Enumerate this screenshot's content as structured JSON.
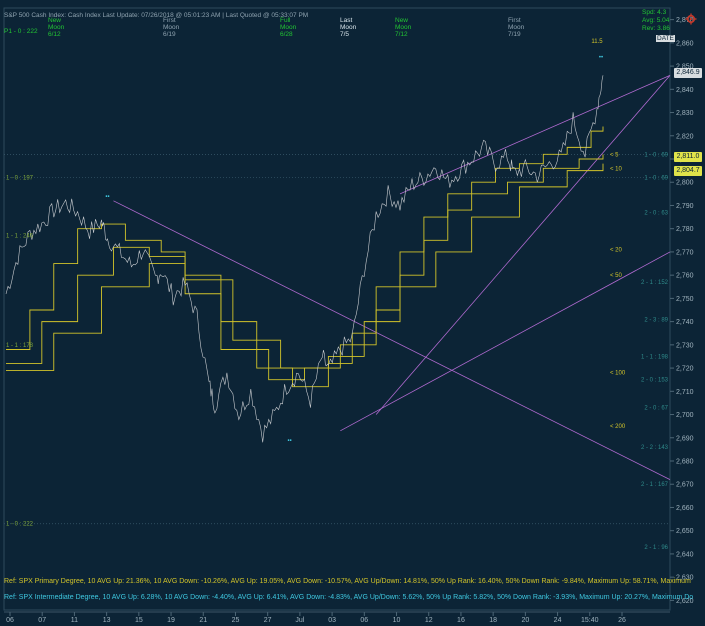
{
  "header": {
    "title": "S&P 500 Cash Index:  Cash Index   Last Update:   07/26/2018 @ 05:01:23 AM | Last Quoted @ 05:33:07 PM",
    "row2_left": "P1 - 0 : 222",
    "lunar": [
      {
        "top": "New",
        "mid": "Moon",
        "date": "6/12",
        "color": "#22c433"
      },
      {
        "top": "First",
        "mid": "Moon",
        "date": "6/19",
        "color": "#8fa3b0"
      },
      {
        "top": "Full",
        "mid": "Moon",
        "date": "6/28",
        "color": "#22c433"
      },
      {
        "top": "Last",
        "mid": "Moon",
        "date": "7/5",
        "color": "#d8e4ea"
      },
      {
        "top": "New",
        "mid": "Moon",
        "date": "7/12",
        "color": "#22c433"
      },
      {
        "top": "First",
        "mid": "Moon",
        "date": "7/19",
        "color": "#8fa3b0"
      }
    ],
    "right_legend": [
      {
        "label": "Spd: 4.3",
        "color": "#22c433"
      },
      {
        "label": "Avg: 5.04",
        "color": "#22c433"
      },
      {
        "label": "Rev: 3.86",
        "color": "#22c433"
      }
    ],
    "right_badge": "DATE"
  },
  "chart_data": {
    "type": "line",
    "title": "S&P 500 Cash Index",
    "xlabel": "",
    "ylabel": "",
    "ylim": [
      2620,
      2875
    ],
    "yticks": [
      2620,
      2630,
      2640,
      2650,
      2660,
      2670,
      2680,
      2690,
      2700,
      2710,
      2720,
      2730,
      2740,
      2750,
      2760,
      2770,
      2780,
      2790,
      2800,
      2810,
      2820,
      2830,
      2840,
      2850,
      2860,
      2870
    ],
    "ytick_labels": [
      "2,620",
      "2,630",
      "2,640",
      "2,650",
      "2,660",
      "2,670",
      "2,680",
      "2,690",
      "2,700",
      "2,710",
      "2,720",
      "2,730",
      "2,740",
      "2,750",
      "2,760",
      "2,770",
      "2,780",
      "2,790",
      "2,800",
      "2,810",
      "2,820",
      "2,830",
      "2,840",
      "2,850",
      "2,860",
      "2,870"
    ],
    "xtick_labels": [
      "06",
      "07",
      "11",
      "13",
      "15",
      "19",
      "21",
      "25",
      "27",
      "Jul",
      "03",
      "06",
      "10",
      "12",
      "16",
      "18",
      "20",
      "24",
      "15:40",
      "26"
    ],
    "price_series": {
      "name": "SPX",
      "color": "#c9ccd0",
      "x": [
        0,
        2,
        4,
        6,
        8,
        10,
        12,
        14,
        16,
        17,
        19,
        21,
        23,
        25,
        26,
        28,
        30,
        32,
        34,
        35,
        37,
        39,
        41,
        43,
        45,
        47,
        49,
        51,
        53,
        54,
        56,
        58,
        60,
        62,
        64,
        66,
        68,
        70,
        72,
        74,
        76,
        78,
        80,
        82,
        84,
        85,
        87,
        89,
        91,
        93,
        95,
        97,
        99,
        100
      ],
      "y": [
        2752,
        2768,
        2778,
        2782,
        2788,
        2791,
        2787,
        2779,
        2783,
        2776,
        2770,
        2764,
        2771,
        2758,
        2762,
        2751,
        2756,
        2742,
        2713,
        2704,
        2718,
        2700,
        2710,
        2692,
        2700,
        2712,
        2718,
        2706,
        2725,
        2719,
        2728,
        2733,
        2763,
        2786,
        2795,
        2790,
        2799,
        2802,
        2807,
        2800,
        2805,
        2810,
        2815,
        2808,
        2811,
        2804,
        2806,
        2803,
        2808,
        2811,
        2827,
        2812,
        2832,
        2846
      ]
    },
    "ma_series": [
      {
        "name": "< 5",
        "color": "#d2c42a"
      },
      {
        "name": "< 10",
        "color": "#d2c42a"
      },
      {
        "name": "< 20",
        "color": "#d2c42a"
      },
      {
        "name": "< 50",
        "color": "#d2c42a"
      },
      {
        "name": "< 100",
        "color": "#d2c42a"
      },
      {
        "name": "< 200",
        "color": "#d2c42a"
      }
    ],
    "last_price": "2,846.9",
    "price_tags": [
      {
        "label": "2,846.9",
        "value": 2846.9,
        "bg": "#d8dde0",
        "fg": "#0c2436"
      },
      {
        "label": "2,811.0",
        "value": 2811.0,
        "bg": "#e0e34a",
        "fg": "#0c2436"
      },
      {
        "label": "2,804.7",
        "value": 2804.7,
        "bg": "#e0e34a",
        "fg": "#0c2436"
      }
    ],
    "peak_label": "11.5",
    "levels_left": [
      {
        "label": "1 - 0 : 197",
        "value": 2802
      },
      {
        "label": "1 - 1 : 246",
        "value": 2777
      },
      {
        "label": "1 - 1 : 178",
        "value": 2730
      },
      {
        "label": "1 - 0 : 222",
        "value": 2653
      }
    ],
    "levels_right": [
      {
        "label": "1 - 0 : 69",
        "value": 2812
      },
      {
        "label": "1 - 0 : 69",
        "value": 2802
      },
      {
        "label": "2 - 0 : 63",
        "value": 2787
      },
      {
        "label": "2 - 1 : 152",
        "value": 2757
      },
      {
        "label": "2 - 3 : 89",
        "value": 2741
      },
      {
        "label": "1 - 1 : 198",
        "value": 2725
      },
      {
        "label": "2 - 0 : 153",
        "value": 2715
      },
      {
        "label": "2 - 0 : 67",
        "value": 2703
      },
      {
        "label": "2 - 2 : 143",
        "value": 2686
      },
      {
        "label": "2 - 1 : 167",
        "value": 2670
      },
      {
        "label": "2 - 1 : 96",
        "value": 2643
      }
    ]
  },
  "stats": {
    "line1": "Ref: SPX Primary Degree, 10 AVG Up: 21.36%, 10 AVG Down: -10.26%, AVG Up: 19.05%, AVG Down: -10.57%, AVG Up/Down: 14.81%, 50%  Up Rank: 16.40%, 50% Down Rank: -9.84%, Maximum Up: 58.71%, Maximum",
    "line2": "Ref: SPX Intermediate Degree, 10 AVG Up: 6.28%, 10 AVG Down: -4.40%, AVG Up: 6.41%, AVG Down: -4.83%, AVG Up/Down: 5.62%, 50%  Up Rank: 5.82%, 50% Down Rank: -3.93%, Maximum Up: 20.27%, Maximum Do",
    "line1_color": "#d2c42a",
    "line2_color": "#3fc8e0"
  }
}
